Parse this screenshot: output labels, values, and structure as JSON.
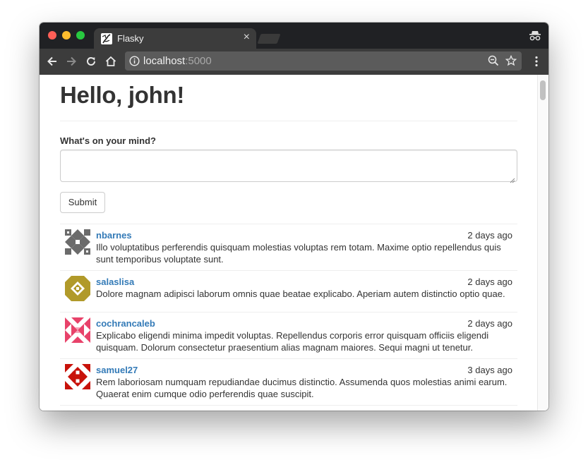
{
  "browser": {
    "tab_title": "Flasky",
    "tab_close": "×",
    "url_host": "localhost",
    "url_port": ":5000"
  },
  "page": {
    "greeting": "Hello, john!",
    "form": {
      "label": "What's on your mind?",
      "textarea_value": "",
      "submit_label": "Submit"
    },
    "posts": [
      {
        "author": "nbarnes",
        "date": "2 days ago",
        "body": "Illo voluptatibus perferendis quisquam molestias voluptas rem totam. Maxime optio repellendus quis sunt temporibus voluptate sunt.",
        "avatar_color": "#6b6b6b"
      },
      {
        "author": "salaslisa",
        "date": "2 days ago",
        "body": "Dolore magnam adipisci laborum omnis quae beatae explicabo. Aperiam autem distinctio optio quae.",
        "avatar_color": "#b19a2a"
      },
      {
        "author": "cochrancaleb",
        "date": "2 days ago",
        "body": "Explicabo eligendi minima impedit voluptas. Repellendus corporis error quisquam officiis eligendi quisquam. Dolorum consectetur praesentium alias magnam maiores. Sequi magni ut tenetur.",
        "avatar_color": "#e8426a"
      },
      {
        "author": "samuel27",
        "date": "3 days ago",
        "body": "Rem laboriosam numquam repudiandae ducimus distinctio. Assumenda quos molestias animi earum. Quaerat enim cumque odio perferendis quae suscipit.",
        "avatar_color": "#c8120a"
      }
    ]
  },
  "colors": {
    "link": "#337ab7",
    "titlebar": "#202124",
    "toolbar": "#3c3c3c"
  }
}
